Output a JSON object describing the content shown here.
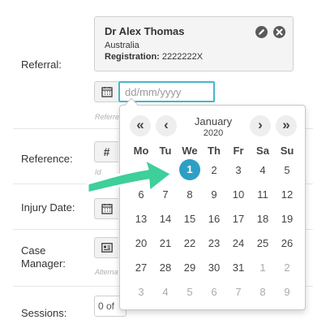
{
  "form": {
    "referral_label": "Referral:",
    "reference_label": "Reference:",
    "injury_date_label": "Injury Date:",
    "case_manager_label": "Case\nManager:",
    "sessions_label": "Sessions:"
  },
  "referral_card": {
    "name": "Dr Alex Thomas",
    "country": "Australia",
    "registration_label": "Registration:",
    "registration_value": "2222222X",
    "edit_icon": "pencil-icon",
    "remove_icon": "close-icon"
  },
  "date_field": {
    "placeholder": "dd/mm/yyyy",
    "help_text": "Referre"
  },
  "reference_field": {
    "icon": "hash-icon",
    "help_text": "Id"
  },
  "case_manager_field": {
    "icon": "id-card-icon",
    "help_text": "Alterna"
  },
  "sessions_field": {
    "value": "0 of"
  },
  "calendar": {
    "month": "January",
    "year": "2020",
    "prev_year_label": "«",
    "prev_month_label": "‹",
    "next_month_label": "›",
    "next_year_label": "»",
    "weekdays": [
      "Mo",
      "Tu",
      "We",
      "Th",
      "Fr",
      "Sa",
      "Su"
    ],
    "weeks": [
      [
        {
          "d": "",
          "m": false
        },
        {
          "d": "",
          "m": false
        },
        {
          "d": "1",
          "m": false,
          "s": true
        },
        {
          "d": "2",
          "m": false
        },
        {
          "d": "3",
          "m": false
        },
        {
          "d": "4",
          "m": false
        },
        {
          "d": "5",
          "m": false
        }
      ],
      [
        {
          "d": "6",
          "m": false
        },
        {
          "d": "7",
          "m": false
        },
        {
          "d": "8",
          "m": false
        },
        {
          "d": "9",
          "m": false
        },
        {
          "d": "10",
          "m": false
        },
        {
          "d": "11",
          "m": false
        },
        {
          "d": "12",
          "m": false
        }
      ],
      [
        {
          "d": "13",
          "m": false
        },
        {
          "d": "14",
          "m": false
        },
        {
          "d": "15",
          "m": false
        },
        {
          "d": "16",
          "m": false
        },
        {
          "d": "17",
          "m": false
        },
        {
          "d": "18",
          "m": false
        },
        {
          "d": "19",
          "m": false
        }
      ],
      [
        {
          "d": "20",
          "m": false
        },
        {
          "d": "21",
          "m": false
        },
        {
          "d": "22",
          "m": false
        },
        {
          "d": "23",
          "m": false
        },
        {
          "d": "24",
          "m": false
        },
        {
          "d": "25",
          "m": false
        },
        {
          "d": "26",
          "m": false
        }
      ],
      [
        {
          "d": "27",
          "m": false
        },
        {
          "d": "28",
          "m": false
        },
        {
          "d": "29",
          "m": false
        },
        {
          "d": "30",
          "m": false
        },
        {
          "d": "31",
          "m": false
        },
        {
          "d": "1",
          "m": true
        },
        {
          "d": "2",
          "m": true
        }
      ],
      [
        {
          "d": "3",
          "m": true
        },
        {
          "d": "4",
          "m": true
        },
        {
          "d": "5",
          "m": true
        },
        {
          "d": "6",
          "m": true
        },
        {
          "d": "7",
          "m": true
        },
        {
          "d": "8",
          "m": true
        },
        {
          "d": "9",
          "m": true
        }
      ]
    ]
  },
  "colors": {
    "accent": "#2e9fc4",
    "input_focus": "#49b5cc",
    "arrow": "#3ecf9a"
  }
}
